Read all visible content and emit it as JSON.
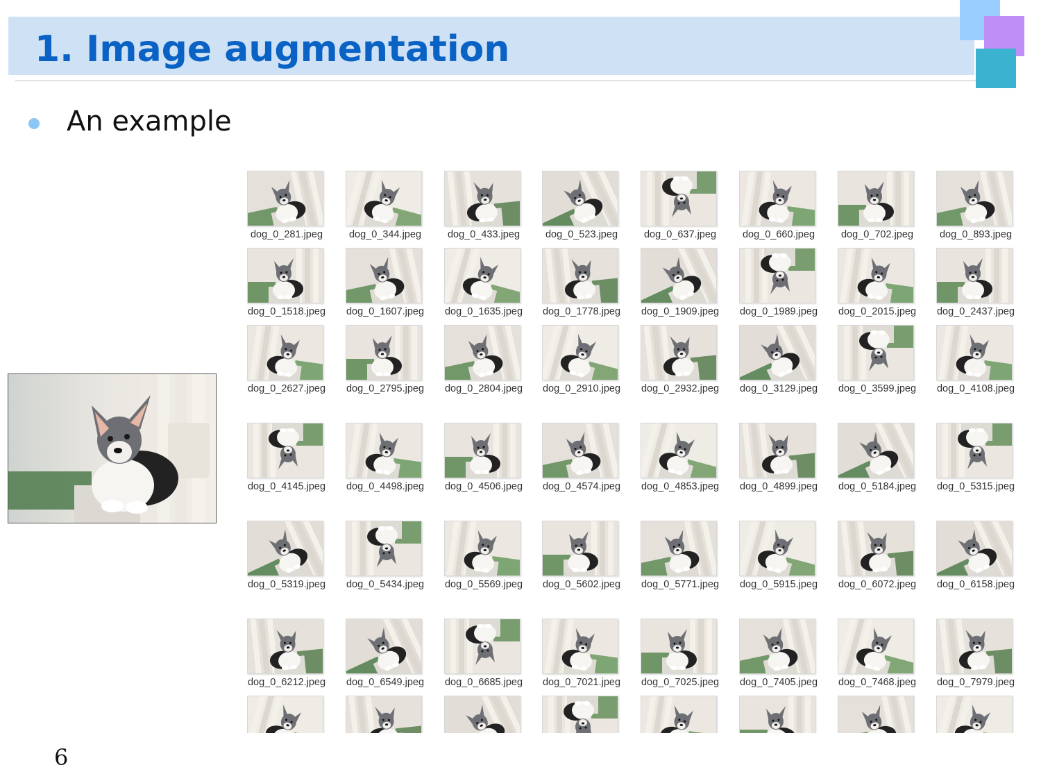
{
  "slide": {
    "title": "1. Image augmentation",
    "bullet": "An example",
    "page_number": "6"
  },
  "original_image": {
    "icon": "dog-photo"
  },
  "thumbnails": [
    "dog_0_281.jpeg",
    "dog_0_344.jpeg",
    "dog_0_433.jpeg",
    "dog_0_523.jpeg",
    "dog_0_637.jpeg",
    "dog_0_660.jpeg",
    "dog_0_702.jpeg",
    "dog_0_893.jpeg",
    "dog_0_1518.jpeg",
    "dog_0_1607.jpeg",
    "dog_0_1635.jpeg",
    "dog_0_1778.jpeg",
    "dog_0_1909.jpeg",
    "dog_0_1989.jpeg",
    "dog_0_2015.jpeg",
    "dog_0_2437.jpeg",
    "dog_0_2627.jpeg",
    "dog_0_2795.jpeg",
    "dog_0_2804.jpeg",
    "dog_0_2910.jpeg",
    "dog_0_2932.jpeg",
    "dog_0_3129.jpeg",
    "dog_0_3599.jpeg",
    "dog_0_4108.jpeg",
    "dog_0_4145.jpeg",
    "dog_0_4498.jpeg",
    "dog_0_4506.jpeg",
    "dog_0_4574.jpeg",
    "dog_0_4853.jpeg",
    "dog_0_4899.jpeg",
    "dog_0_5184.jpeg",
    "dog_0_5315.jpeg",
    "dog_0_5319.jpeg",
    "dog_0_5434.jpeg",
    "dog_0_5569.jpeg",
    "dog_0_5602.jpeg",
    "dog_0_5771.jpeg",
    "dog_0_5915.jpeg",
    "dog_0_6072.jpeg",
    "dog_0_6158.jpeg",
    "dog_0_6212.jpeg",
    "dog_0_6549.jpeg",
    "dog_0_6685.jpeg",
    "dog_0_7021.jpeg",
    "dog_0_7025.jpeg",
    "dog_0_7405.jpeg",
    "dog_0_7468.jpeg",
    "dog_0_7979.jpeg",
    "",
    "",
    "",
    "",
    "",
    "",
    "",
    ""
  ],
  "colors": {
    "title": "#0a62c4",
    "title_bar": "#cfe2f5",
    "bullet_dot": "#8cc6f4",
    "accent_blue": "#99ccff",
    "accent_purple": "#bf8ff7",
    "accent_teal": "#3bb2d0"
  }
}
